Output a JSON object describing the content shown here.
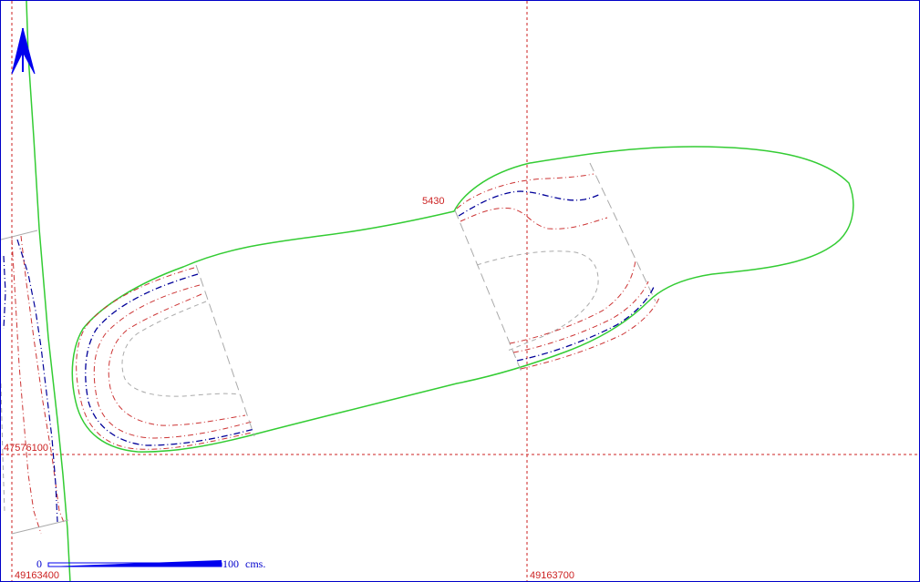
{
  "map": {
    "colors": {
      "background": "#ffffff",
      "frame": "#0000c8",
      "grid": "#cc2222",
      "outline": "#33cc33",
      "contour_red": "#cc3333",
      "contour_blue": "#000099",
      "gray_line": "#aaaaaa",
      "north_arrow": "#0000ee",
      "scale_bar": "#0000ee"
    },
    "grid_labels": {
      "easting_left": "49163400",
      "easting_right": "49163700",
      "northing": "47576100"
    },
    "annotation": "5430",
    "scale_bar": {
      "start_label": "0",
      "end_label": "100",
      "unit": "cms."
    },
    "north_arrow": "north-arrow-icon"
  }
}
